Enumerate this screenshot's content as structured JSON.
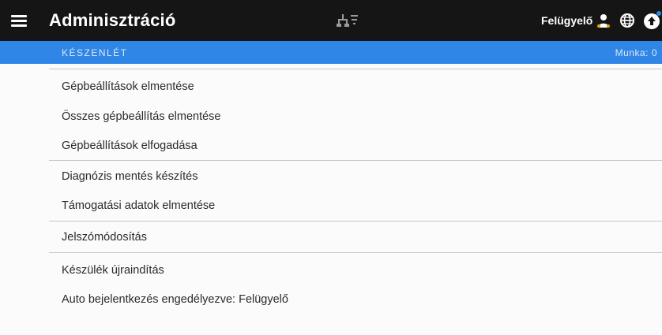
{
  "header": {
    "menu_icon": "hamburger-icon",
    "title": "Adminisztráció",
    "center_icon": "network-filter-icon",
    "user_name": "Felügyelő",
    "user_icon": "user-icon",
    "globe_icon": "globe-icon",
    "action_icon": "circle-arrow-icon"
  },
  "status": {
    "left": "KÉSZENLÉT",
    "right": "Munka: 0"
  },
  "menu": {
    "items": [
      "Gépbeállítások elmentése",
      "Összes gépbeállítás elmentése",
      "Gépbeállítások elfogadása",
      "Diagnózis mentés készítés",
      "Támogatási adatok elmentése",
      "Jelszómódosítás",
      "Készülék újraindítás",
      "Auto bejelentkezés engedélyezve: Felügyelő"
    ]
  },
  "colors": {
    "header_bg": "#151515",
    "status_bg": "#2f86e6",
    "page_bg": "#fbfbfb",
    "divider": "#c7c7c7"
  }
}
